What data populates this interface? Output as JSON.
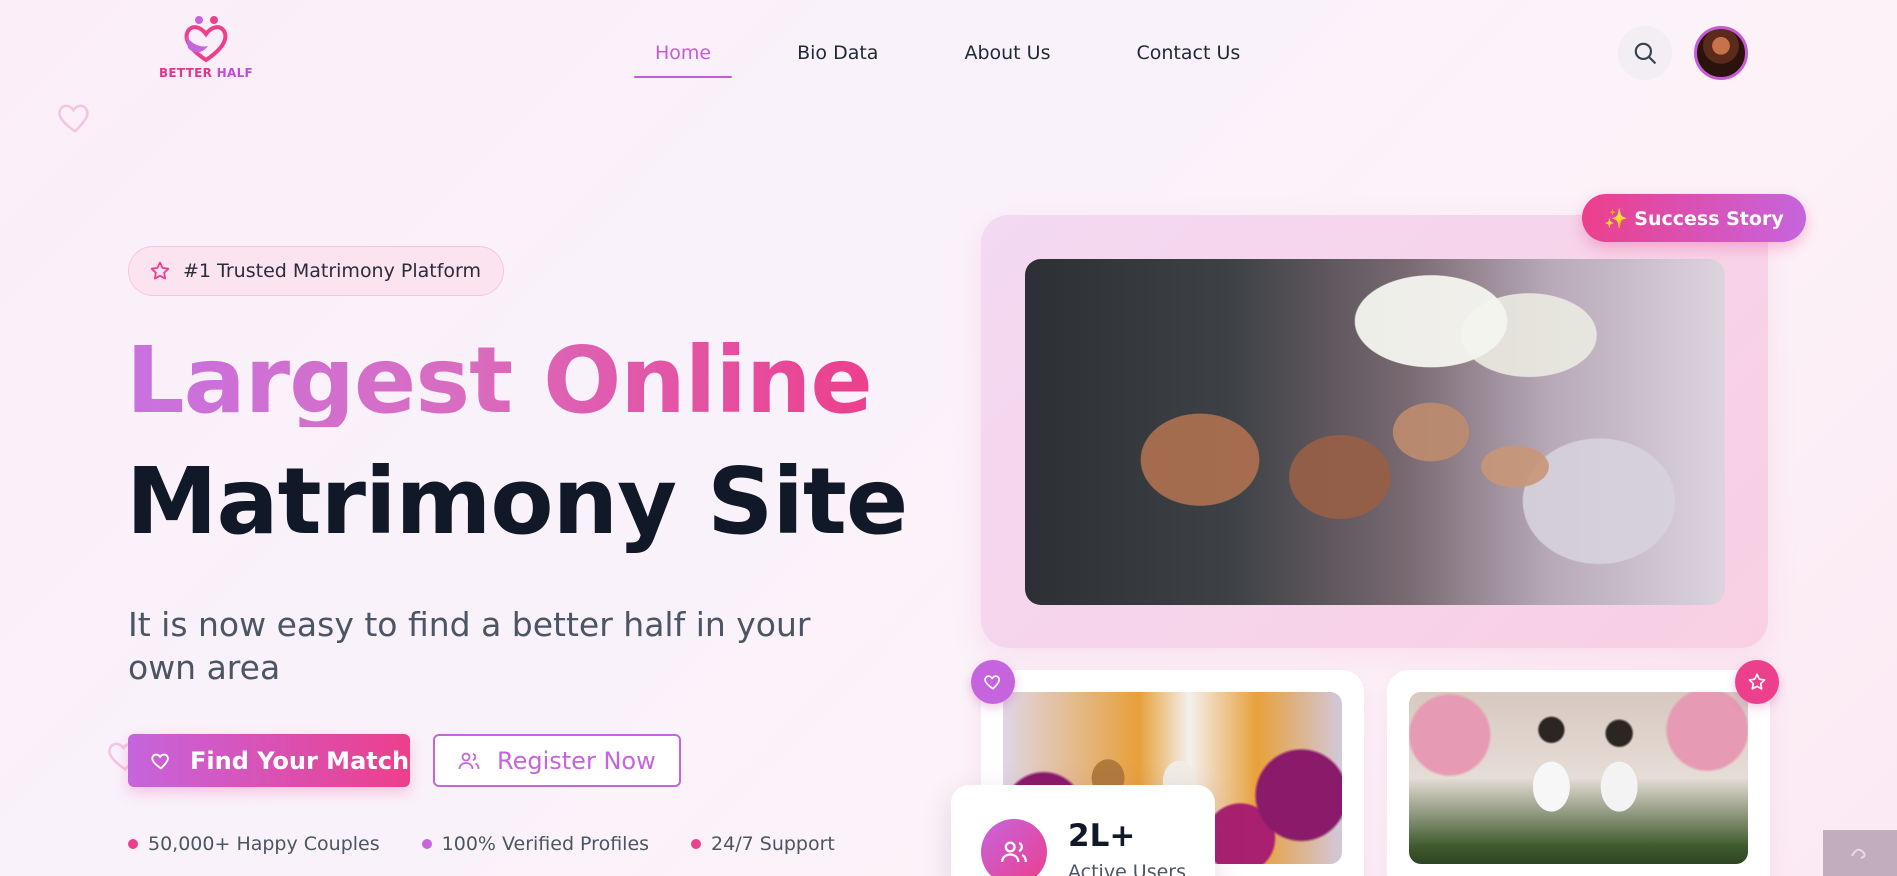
{
  "brand": {
    "name_part1": "BETTER",
    "name_part2": "HALF"
  },
  "nav": {
    "items": [
      {
        "label": "Home",
        "active": true
      },
      {
        "label": "Bio Data",
        "active": false
      },
      {
        "label": "About Us",
        "active": false
      },
      {
        "label": "Contact Us",
        "active": false
      }
    ]
  },
  "hero": {
    "badge": "#1 Trusted Matrimony Platform",
    "title_line1": "Largest Online",
    "title_line2": "Matrimony Site",
    "subtitle": "It is now easy to find a better half in your own area",
    "primary_button": "Find Your Match",
    "secondary_button": "Register Now",
    "features": [
      {
        "label": "50,000+ Happy Couples",
        "color": "#ec3f8c"
      },
      {
        "label": "100% Verified Profiles",
        "color": "#c664dd"
      },
      {
        "label": "24/7 Support",
        "color": "#ec3f8c"
      }
    ]
  },
  "showcase": {
    "success_pill": "✨ Success Story",
    "stat_value": "2L+",
    "stat_label": "Active Users"
  },
  "colors": {
    "accent_purple": "#c664dd",
    "accent_pink": "#ec3f8c",
    "text_dark": "#111827"
  },
  "icons": [
    "search-icon",
    "heart-icon",
    "star-icon",
    "users-icon",
    "logo-icon"
  ]
}
